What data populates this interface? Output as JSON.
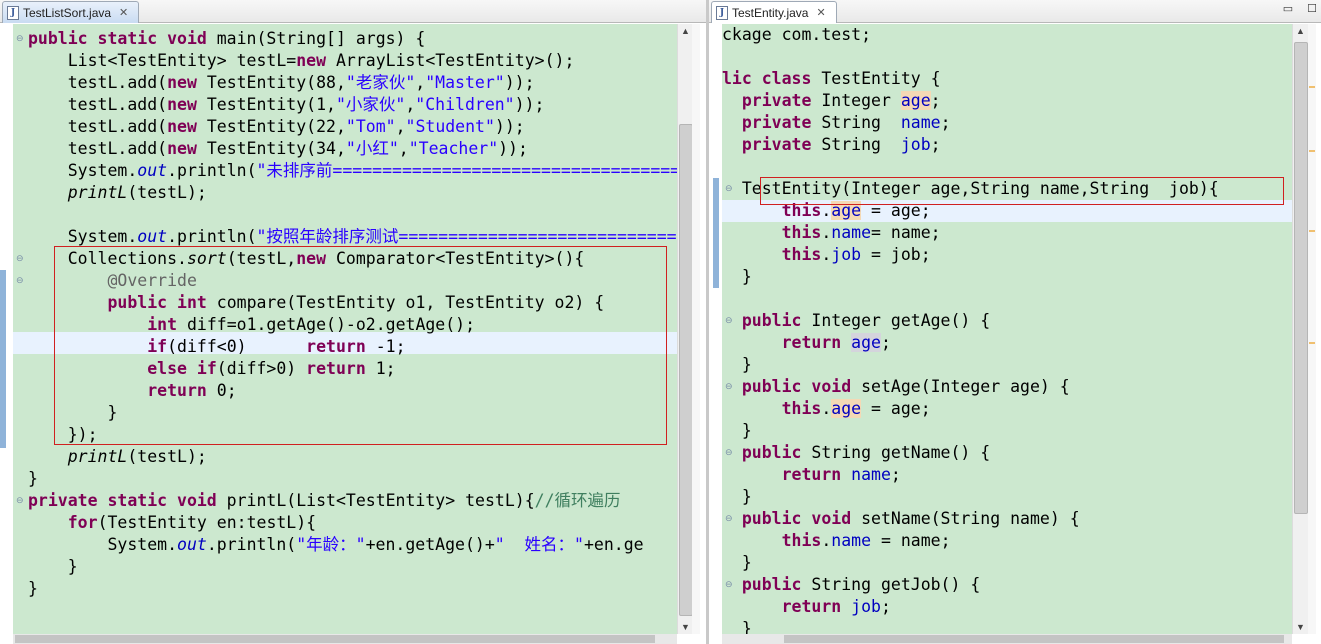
{
  "left_tab": {
    "title": "TestListSort.java",
    "close": "✕"
  },
  "right_tab": {
    "title": "TestEntity.java",
    "close": "✕"
  },
  "view_controls": {
    "minimize": "▭",
    "maximize": "☐"
  },
  "left_code": {
    "l1": [
      "public static void",
      " main(String[] args) {"
    ],
    "l2": [
      "    List<TestEntity> testL=",
      "new",
      " ArrayList<TestEntity>();"
    ],
    "l3": [
      "    testL.add(",
      "new",
      " TestEntity(88,",
      "\"老家伙\"",
      ",",
      "\"Master\"",
      "));"
    ],
    "l4": [
      "    testL.add(",
      "new",
      " TestEntity(1,",
      "\"小家伙\"",
      ",",
      "\"Children\"",
      "));"
    ],
    "l5": [
      "    testL.add(",
      "new",
      " TestEntity(22,",
      "\"Tom\"",
      ",",
      "\"Student\"",
      "));"
    ],
    "l6": [
      "    testL.add(",
      "new",
      " TestEntity(34,",
      "\"小红\"",
      ",",
      "\"Teacher\"",
      "));"
    ],
    "l7": [
      "    System.",
      "out",
      ".println(",
      "\"未排序前============================================"
    ],
    "l8": [
      "    ",
      "printL",
      "(testL);"
    ],
    "l10": [
      "    System.",
      "out",
      ".println(",
      "\"按照年龄排序测试============================================"
    ],
    "l11": [
      "    Collections.",
      "sort",
      "(testL,",
      "new",
      " Comparator<TestEntity>(){"
    ],
    "l12": [
      "        ",
      "@Override"
    ],
    "l13": [
      "        ",
      "public int",
      " compare(TestEntity o1, TestEntity o2) {"
    ],
    "l14": [
      "            ",
      "int",
      " diff=o1.getAge()-o2.getAge();"
    ],
    "l15": [
      "            ",
      "if",
      "(diff<0)      ",
      "return",
      " -1;"
    ],
    "l16": [
      "            ",
      "else if",
      "(diff>0) ",
      "return",
      " 1;"
    ],
    "l17": [
      "            ",
      "return",
      " 0;"
    ],
    "l18": [
      "        }"
    ],
    "l19": [
      "    });"
    ],
    "l20": [
      "    ",
      "printL",
      "(testL);"
    ],
    "l21": [
      "}"
    ],
    "l22": [
      "private static void",
      " printL(List<TestEntity> testL){",
      "//循环遍历"
    ],
    "l23": [
      "    ",
      "for",
      "(TestEntity en:testL){"
    ],
    "l24": [
      "        System.",
      "out",
      ".println(",
      "\"年龄：\"",
      "+en.getAge()+",
      "\"  姓名：\"",
      "+en.ge"
    ],
    "l25": [
      "    }"
    ],
    "l26": [
      "}"
    ]
  },
  "right_code": {
    "r1": [
      "ckage com.test;"
    ],
    "r3": [
      "lic",
      " ",
      "class",
      " TestEntity {"
    ],
    "r4": [
      "  ",
      "private",
      " Integer ",
      "age",
      ";"
    ],
    "r5": [
      "  ",
      "private",
      " String  ",
      "name",
      ";"
    ],
    "r6": [
      "  ",
      "private",
      " String  ",
      "job",
      ";"
    ],
    "r8": [
      "  TestEntity(Integer age,String name,String  job){"
    ],
    "r9": [
      "      ",
      "this",
      ".",
      "age",
      " = age;"
    ],
    "r10": [
      "      ",
      "this",
      ".",
      "name",
      "= name;"
    ],
    "r11": [
      "      ",
      "this",
      ".",
      "job",
      " = job;"
    ],
    "r12": [
      "  }"
    ],
    "r14": [
      "  ",
      "public",
      " Integer getAge() {"
    ],
    "r15": [
      "      ",
      "return",
      " ",
      "age",
      ";"
    ],
    "r16": [
      "  }"
    ],
    "r17": [
      "  ",
      "public void",
      " setAge(Integer age) {"
    ],
    "r18": [
      "      ",
      "this",
      ".",
      "age",
      " = age;"
    ],
    "r19": [
      "  }"
    ],
    "r20": [
      "  ",
      "public",
      " String getName() {"
    ],
    "r21": [
      "      ",
      "return",
      " ",
      "name",
      ";"
    ],
    "r22": [
      "  }"
    ],
    "r23": [
      "  ",
      "public void",
      " setName(String name) {"
    ],
    "r24": [
      "      ",
      "this",
      ".",
      "name",
      " = name;"
    ],
    "r25": [
      "  }"
    ],
    "r26": [
      "  ",
      "public",
      " String getJob() {"
    ],
    "r27": [
      "      ",
      "return",
      " ",
      "job",
      ";"
    ],
    "r28": [
      "  }"
    ]
  },
  "icons": {
    "fold": "⊖",
    "scroll_up": "▲",
    "scroll_down": "▼",
    "file": "J"
  },
  "colors": {
    "editor_bg": "#cce8cf",
    "keyword": "#7f0055",
    "string": "#2a00ff",
    "field": "#0000c0",
    "highlight_box": "#d02020"
  }
}
